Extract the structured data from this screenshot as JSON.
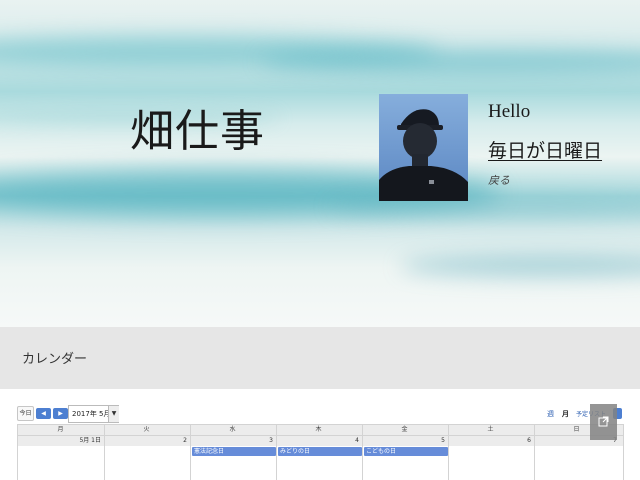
{
  "hero": {
    "site_title": "畑仕事",
    "greeting": "Hello",
    "blog_link": "毎日が日曜日",
    "back_link": "戻る"
  },
  "section": {
    "title": "カレンダー"
  },
  "calendar": {
    "toolbar": {
      "today_label": "今日",
      "prev_label": "◀",
      "next_label": "▶",
      "month_value": "2017年 5月",
      "dropdown_label": "▼",
      "view_week": "週",
      "view_month": "月",
      "view_agenda": "予定リスト"
    },
    "weekdays": [
      "月",
      "火",
      "水",
      "木",
      "金",
      "土",
      "日"
    ],
    "dates": [
      "5月 1日",
      "2",
      "3",
      "4",
      "5",
      "6",
      "7"
    ],
    "events": [
      {
        "title": "憲法記念日",
        "day_index": 2
      },
      {
        "title": "みどりの日",
        "day_index": 3
      },
      {
        "title": "こどもの日",
        "day_index": 4
      }
    ],
    "popout_icon": "external-link-icon",
    "accent_color": "#4d7fd1",
    "event_color": "#668cd9"
  }
}
